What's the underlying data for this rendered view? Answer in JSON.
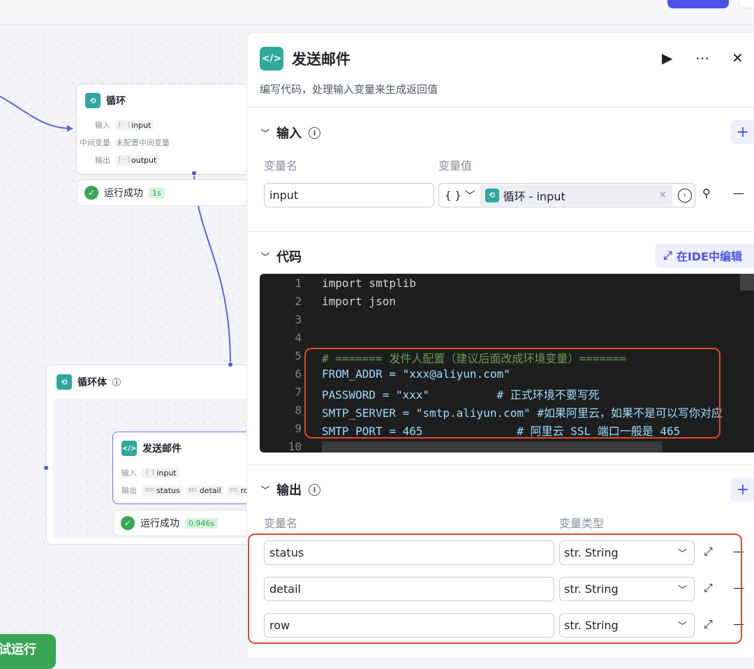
{
  "canvas": {
    "loop_node": {
      "title": "循环",
      "rows": [
        {
          "label": "输入",
          "tag_prefix": "[⋯]",
          "tag": "input"
        },
        {
          "label": "中间变量",
          "text": "未配置中间变量"
        },
        {
          "label": "输出",
          "tag_prefix": "[⋯]",
          "tag": "output"
        }
      ],
      "status": "运行成功",
      "time": "1s"
    },
    "loop_body": {
      "title": "循环体"
    },
    "email_node": {
      "title": "发送邮件",
      "input_label": "输入",
      "input_prefix": "{ }",
      "input_tag": "input",
      "output_label": "输出",
      "outputs": [
        {
          "prefix": "str.",
          "name": "status"
        },
        {
          "prefix": "str.",
          "name": "detail"
        },
        {
          "prefix": "str.",
          "name": "ro"
        }
      ],
      "status": "运行成功",
      "time": "0.946s"
    },
    "run_button": "试运行"
  },
  "panel": {
    "title": "发送邮件",
    "description": "编写代码，处理输入变量来生成返回值",
    "input_section": {
      "title": "输入",
      "col_name": "变量名",
      "col_value": "变量值",
      "var_name": "input",
      "type_symbol": "{ }",
      "ref_label": "循环 - input"
    },
    "code_section": {
      "title": "代码",
      "ide_button": "在IDE中编辑",
      "lines": [
        {
          "no": "1",
          "text": "import smtplib"
        },
        {
          "no": "2",
          "text": "import json"
        },
        {
          "no": "3",
          "text": ""
        },
        {
          "no": "4",
          "text": ""
        },
        {
          "no": "5",
          "text": "# ======= 发件人配置（建议后面改成环境变量）======="
        },
        {
          "no": "6",
          "text": "FROM_ADDR = \"xxx@aliyun.com\""
        },
        {
          "no": "7",
          "text": "PASSWORD = \"xxx\"          # 正式环境不要写死"
        },
        {
          "no": "8",
          "text": "SMTP_SERVER = \"smtp.aliyun.com\" #如果阿里云，如果不是可以写你对应"
        },
        {
          "no": "9",
          "text": "SMTP_PORT = 465              # 阿里云 SSL 端口一般是 465"
        },
        {
          "no": "10",
          "text": ""
        }
      ]
    },
    "output_section": {
      "title": "输出",
      "col_name": "变量名",
      "col_type": "变量类型",
      "rows": [
        {
          "name": "status",
          "type": "str. String"
        },
        {
          "name": "detail",
          "type": "str. String"
        },
        {
          "name": "row",
          "type": "str. String"
        }
      ]
    }
  },
  "colors": {
    "accent": "#4d53e8",
    "node_icon": "#2fa8a0",
    "success": "#3aa655",
    "highlight": "#e0492f"
  }
}
